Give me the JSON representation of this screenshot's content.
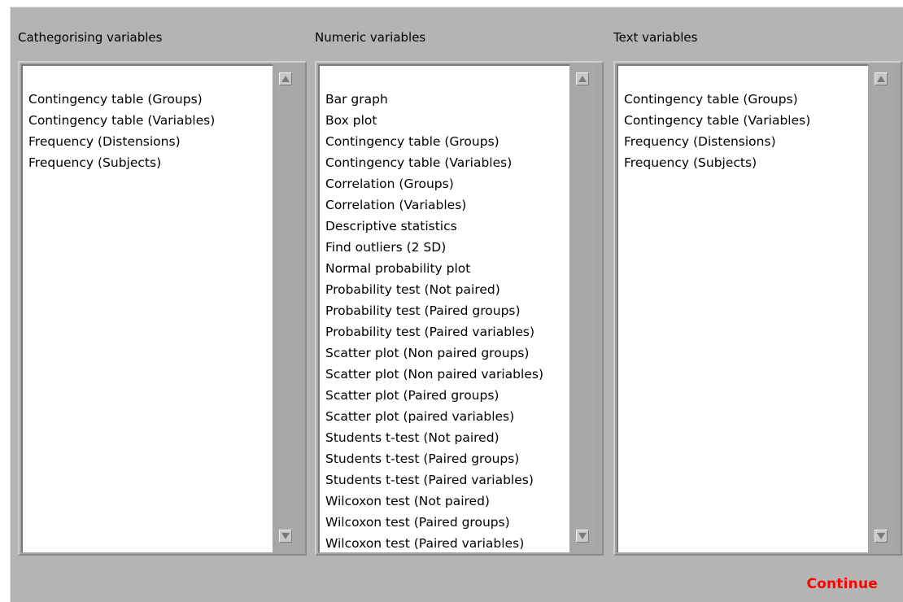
{
  "panels": [
    {
      "label": "Cathegorising variables",
      "items": [
        "Contingency table (Groups)",
        "Contingency table (Variables)",
        "Frequency (Distensions)",
        "Frequency (Subjects)"
      ]
    },
    {
      "label": "Numeric variables",
      "items": [
        "Bar graph",
        "Box plot",
        "Contingency table (Groups)",
        "Contingency table (Variables)",
        "Correlation (Groups)",
        "Correlation (Variables)",
        "Descriptive statistics",
        "Find outliers (2 SD)",
        "Normal probability plot",
        "Probability test (Not paired)",
        "Probability test (Paired groups)",
        "Probability test (Paired variables)",
        "Scatter plot (Non paired groups)",
        "Scatter plot (Non paired variables)",
        "Scatter plot (Paired groups)",
        "Scatter plot (paired variables)",
        "Students t-test (Not paired)",
        "Students t-test (Paired groups)",
        "Students t-test (Paired variables)",
        "Wilcoxon test (Not paired)",
        "Wilcoxon test (Paired groups)",
        "Wilcoxon test (Paired variables)"
      ]
    },
    {
      "label": "Text variables",
      "items": [
        "Contingency table (Groups)",
        "Contingency table (Variables)",
        "Frequency (Distensions)",
        "Frequency (Subjects)"
      ]
    }
  ],
  "scroll_icons": {
    "up": "scroll-up-arrow-icon",
    "down": "scroll-down-arrow-icon"
  },
  "footer": {
    "continue_label": "Continue"
  },
  "colors": {
    "window_bg": "#b4b4b4",
    "list_bg": "#ffffff",
    "continue_text": "#ff0000"
  }
}
